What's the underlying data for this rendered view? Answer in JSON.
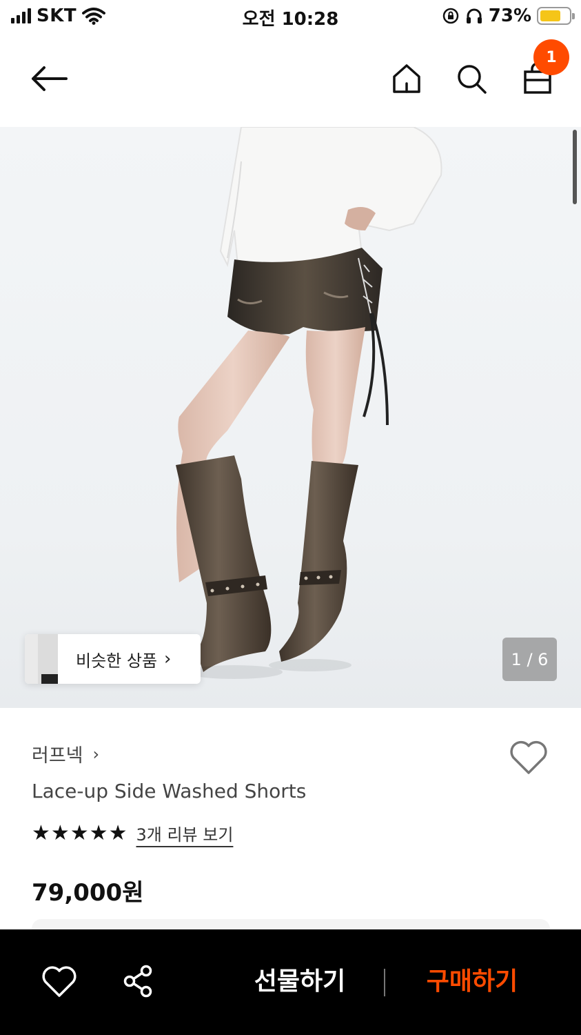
{
  "status_bar": {
    "carrier": "SKT",
    "time": "오전 10:28",
    "battery_percent": "73%",
    "battery_level": 0.73,
    "battery_color": "#f5c518"
  },
  "header": {
    "back_icon": "arrow-left-icon",
    "home_icon": "home-icon",
    "search_icon": "search-icon",
    "cart_icon": "shopping-bag-icon",
    "cart_count": "1",
    "badge_color": "#ff4b00"
  },
  "gallery": {
    "similar_products_label": "비슷한 상품",
    "page_indicator": "1 / 6",
    "current_page": 1,
    "total_pages": 6
  },
  "product": {
    "brand": "러프넥",
    "title": "Lace-up Side Washed Shorts",
    "rating_stars": "★★★★★",
    "rating": 5,
    "review_link": "3개 리뷰 보기",
    "price": "79,000원"
  },
  "bottom_bar": {
    "wish_icon": "heart-outline-icon",
    "share_icon": "share-icon",
    "gift_label": "선물하기",
    "buy_label": "구매하기",
    "buy_color": "#ff4b00"
  }
}
